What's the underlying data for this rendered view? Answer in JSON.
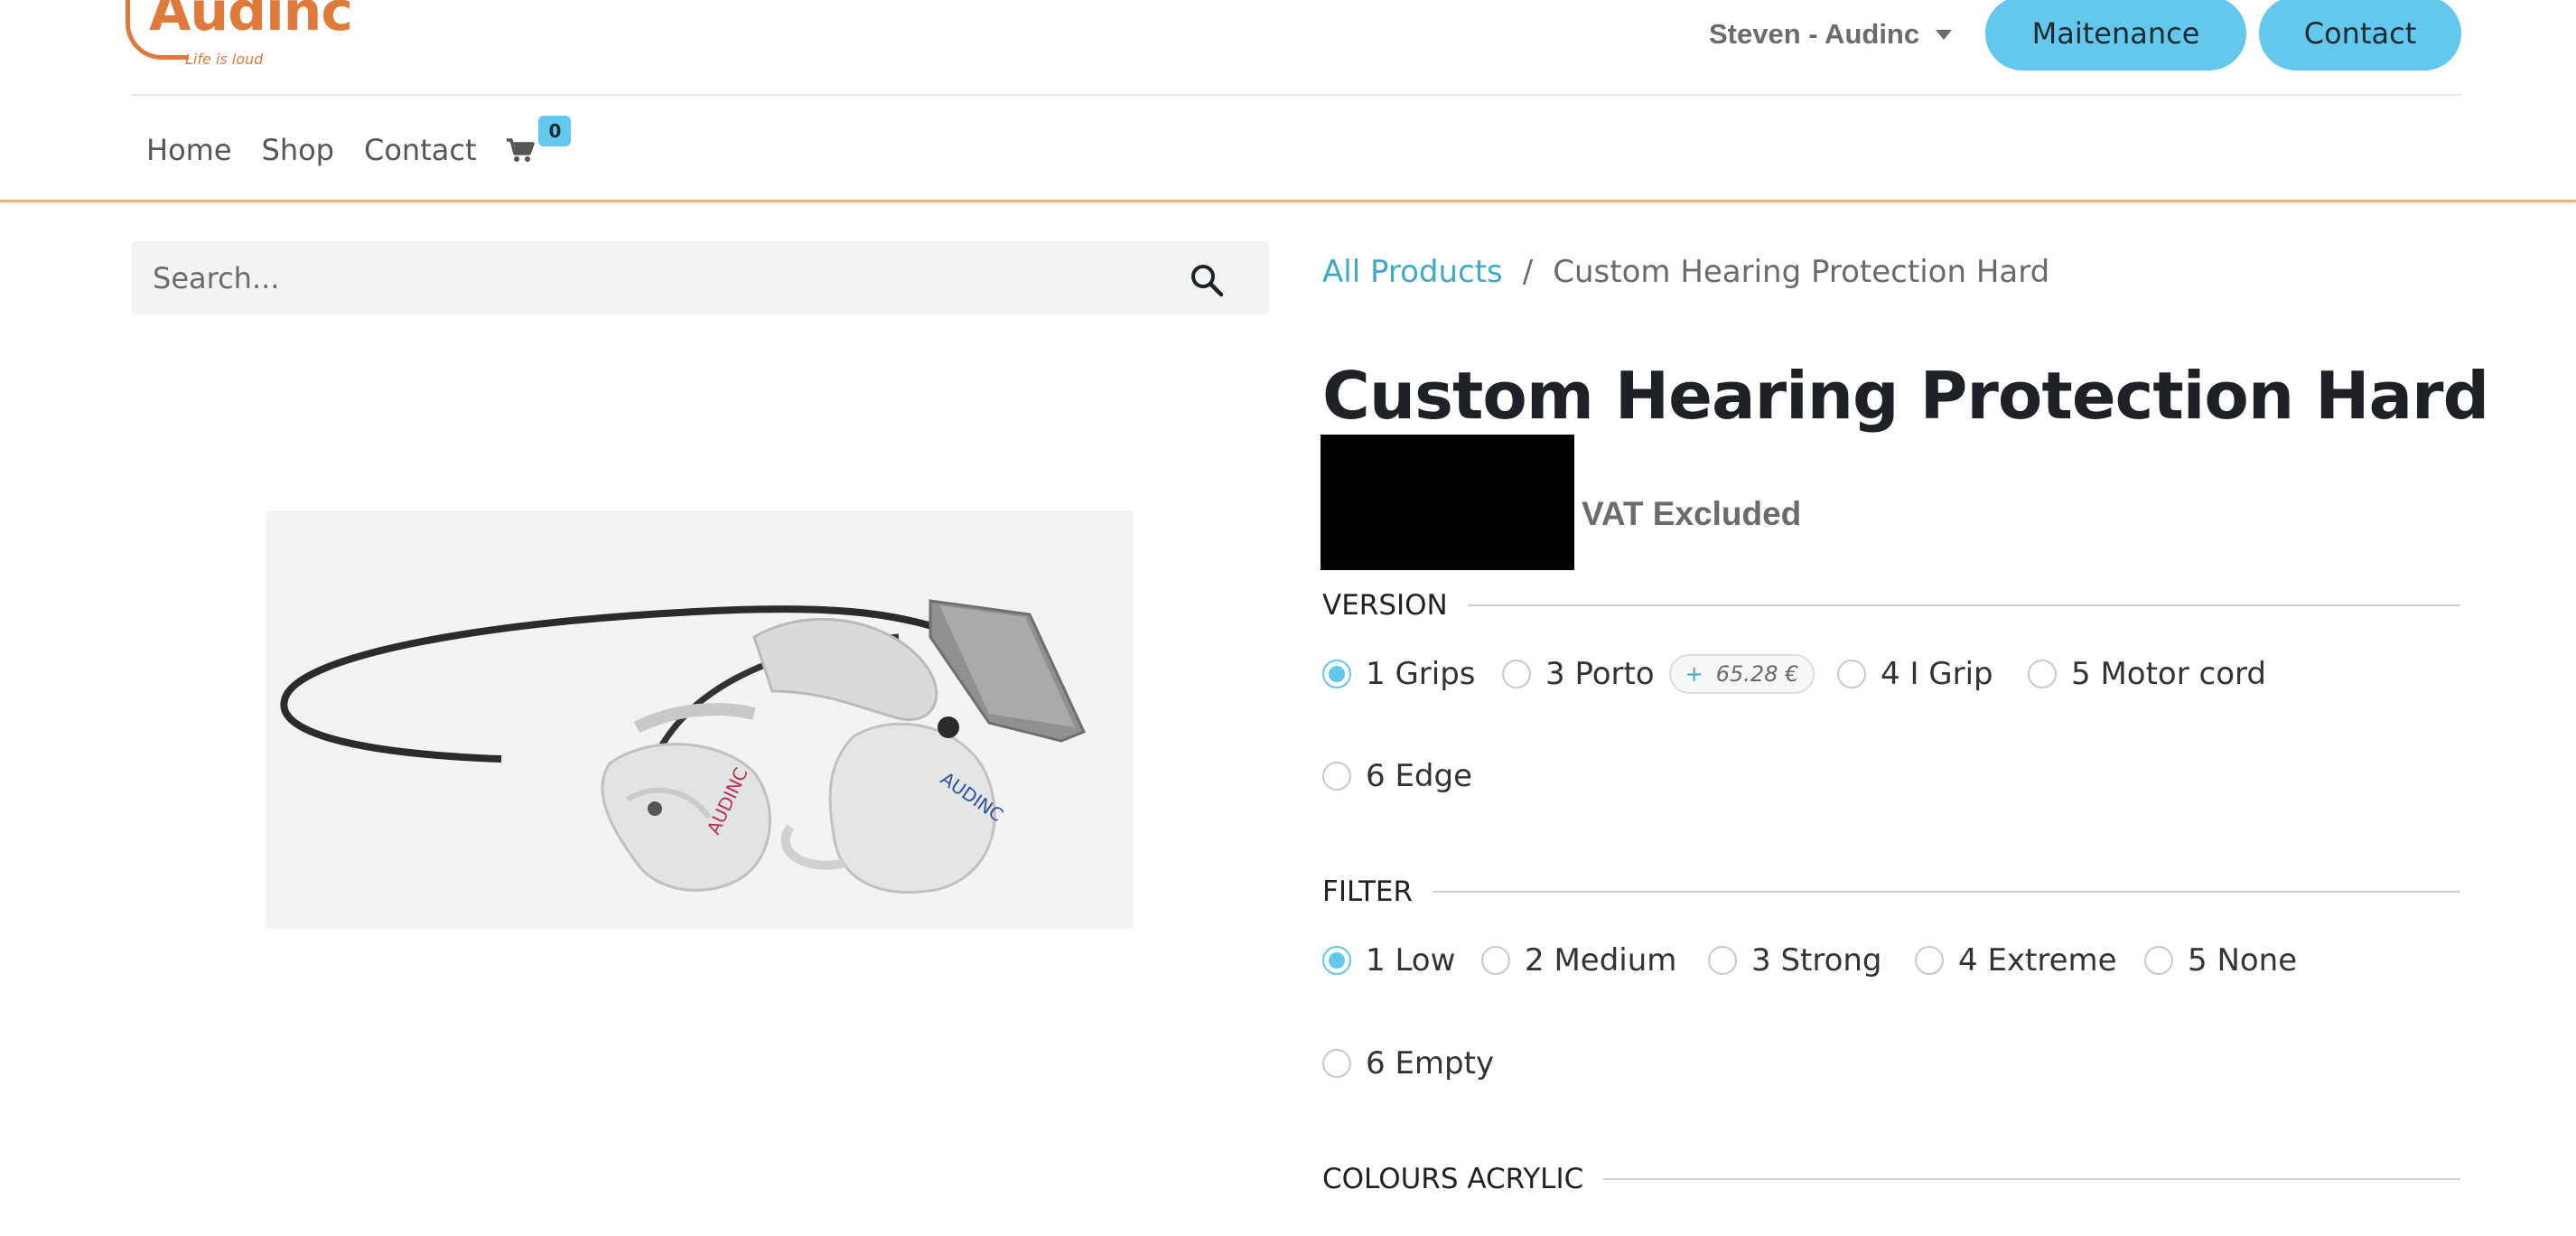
{
  "brand": {
    "name": "Audinc",
    "tagline": "Life is loud",
    "reg": "®"
  },
  "header": {
    "user_label": "Steven - Audinc",
    "buttons": {
      "maintenance": "Maitenance",
      "contact": "Contact"
    },
    "nav": [
      "Home",
      "Shop",
      "Contact"
    ],
    "cart_count": "0"
  },
  "search": {
    "placeholder": "Search..."
  },
  "breadcrumb": {
    "parent": "All Products",
    "separator": "/",
    "current": "Custom Hearing Protection Hard"
  },
  "product": {
    "title": "Custom Hearing Protection Hard",
    "vat_note": "VAT Excluded"
  },
  "attributes": {
    "version": {
      "label": "VERSION",
      "options": [
        "1 Grips",
        "3 Porto",
        "4 I Grip",
        "5 Motor cord",
        "6 Edge"
      ],
      "selected": "1 Grips",
      "extra_price": {
        "plus": "+",
        "amount": "65.28 €"
      }
    },
    "filter": {
      "label": "FILTER",
      "options": [
        "1 Low",
        "2 Medium",
        "3 Strong",
        "4 Extreme",
        "5 None",
        "6 Empty"
      ],
      "selected": "1 Low"
    },
    "colours": {
      "label": "COLOURS ACRYLIC"
    }
  },
  "colors": {
    "accent": "#63c8ec",
    "brand": "#e07a3c",
    "link": "#3fa9c8",
    "header_border": "#e8b968"
  }
}
